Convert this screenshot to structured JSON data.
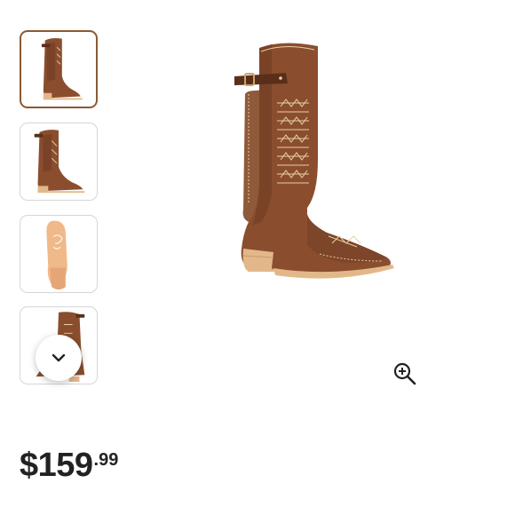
{
  "gallery": {
    "thumbnails": [
      {
        "icon": "boot-side-view-thumbnail",
        "selected": true
      },
      {
        "icon": "boot-angled-view-thumbnail",
        "selected": false
      },
      {
        "icon": "boot-sole-view-thumbnail",
        "selected": false
      },
      {
        "icon": "boot-back-view-thumbnail",
        "selected": false
      }
    ],
    "scroll_icon": "chevron-down-icon",
    "zoom_icon": "zoom-in-icon"
  },
  "product": {
    "price_main": "$159",
    "price_cents": ".99"
  },
  "colors": {
    "leather": "#8a4e2e",
    "leather_dark": "#6e3b22",
    "stitch": "#e8cfa6",
    "heel": "#e2b88a",
    "selected_border": "#8a5a34",
    "price_text": "#222222"
  }
}
